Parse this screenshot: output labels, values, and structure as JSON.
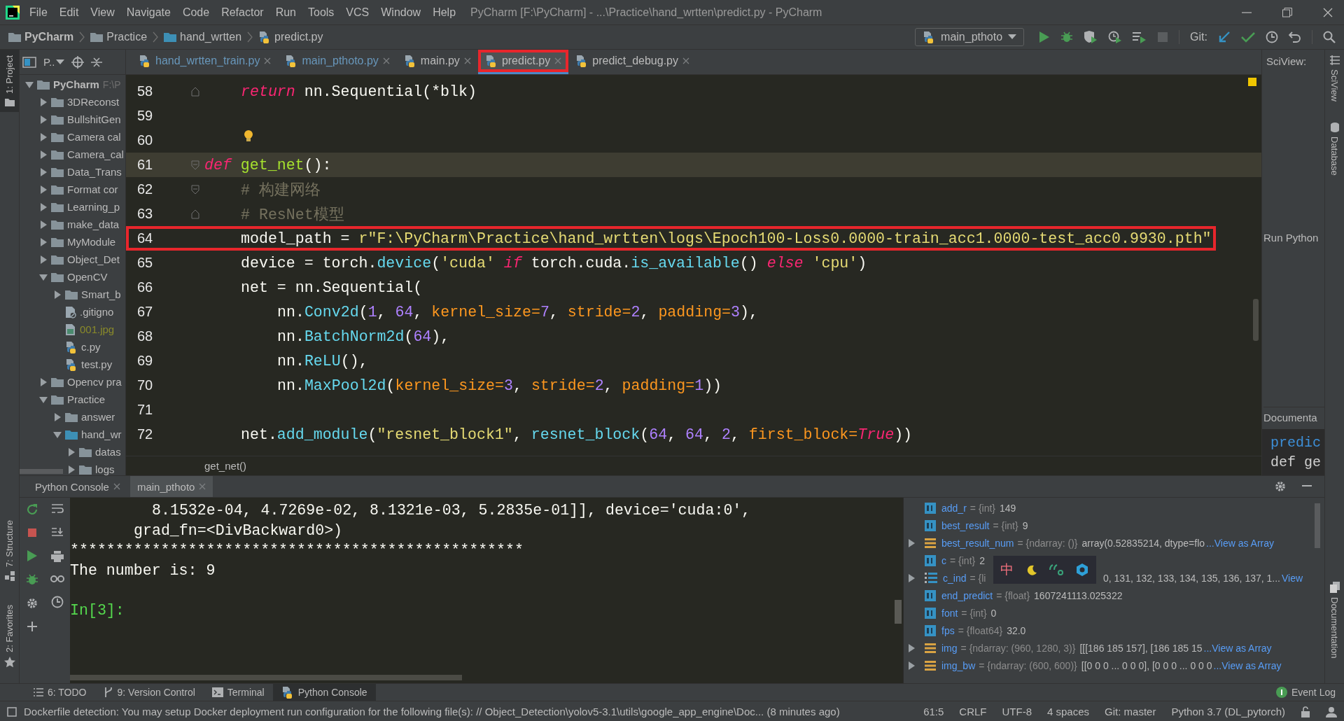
{
  "menu_bar": {
    "items": [
      "File",
      "Edit",
      "View",
      "Navigate",
      "Code",
      "Refactor",
      "Run",
      "Tools",
      "VCS",
      "Window",
      "Help"
    ],
    "title": "PyCharm [F:\\PyCharm] - ...\\Practice\\hand_wrtten\\predict.py - PyCharm"
  },
  "nav_bar": {
    "breadcrumbs": [
      {
        "label": "PyCharm",
        "kind": "project"
      },
      {
        "label": "Practice",
        "kind": "folder"
      },
      {
        "label": "hand_wrtten",
        "kind": "source-folder"
      },
      {
        "label": "predict.py",
        "kind": "python"
      }
    ],
    "run_config": "main_pthoto",
    "git_label": "Git:"
  },
  "left_strip": [
    {
      "label": "1: Project",
      "selected": true
    },
    {
      "label": "7: Structure",
      "selected": false
    },
    {
      "label": "2: Favorites",
      "selected": false
    }
  ],
  "project": {
    "header": "P..",
    "tree": [
      {
        "label": "PyCharm",
        "hint": "F:\\P",
        "kind": "folder",
        "expanded": true,
        "children": [
          {
            "label": "3DReconst",
            "kind": "folder",
            "expanded": false
          },
          {
            "label": "BullshitGen",
            "kind": "folder",
            "expanded": false
          },
          {
            "label": "Camera cal",
            "kind": "folder",
            "expanded": false
          },
          {
            "label": "Camera_cal",
            "kind": "folder",
            "expanded": false
          },
          {
            "label": "Data_Trans",
            "kind": "folder",
            "expanded": false
          },
          {
            "label": "Format cor",
            "kind": "folder",
            "expanded": false
          },
          {
            "label": "Learning_p",
            "kind": "folder",
            "expanded": false
          },
          {
            "label": "make_data",
            "kind": "folder",
            "expanded": false
          },
          {
            "label": "MyModule",
            "kind": "folder",
            "expanded": false
          },
          {
            "label": "Object_Det",
            "kind": "folder",
            "expanded": false
          },
          {
            "label": "OpenCV",
            "kind": "folder",
            "expanded": true,
            "children": [
              {
                "label": "Smart_b",
                "kind": "folder",
                "expanded": false
              },
              {
                "label": ".gitigno",
                "kind": "ignore-file"
              },
              {
                "label": "001.jpg",
                "kind": "image"
              },
              {
                "label": "c.py",
                "kind": "python"
              },
              {
                "label": "test.py",
                "kind": "python"
              }
            ]
          },
          {
            "label": "Opencv pra",
            "kind": "folder",
            "expanded": false
          },
          {
            "label": "Practice",
            "kind": "folder",
            "expanded": true,
            "children": [
              {
                "label": "answer",
                "kind": "folder",
                "expanded": false
              },
              {
                "label": "hand_wr",
                "kind": "source-folder",
                "expanded": true,
                "children": [
                  {
                    "label": "datas",
                    "kind": "folder",
                    "expanded": false
                  },
                  {
                    "label": "logs",
                    "kind": "folder",
                    "expanded": false
                  }
                ]
              }
            ]
          }
        ]
      }
    ]
  },
  "editor": {
    "tabs": [
      {
        "label": "hand_wrtten_train.py",
        "modified": true,
        "selected": false,
        "annotated": false
      },
      {
        "label": "main_pthoto.py",
        "modified": true,
        "selected": false,
        "annotated": false
      },
      {
        "label": "main.py",
        "modified": false,
        "selected": false,
        "annotated": false
      },
      {
        "label": "predict.py",
        "modified": false,
        "selected": true,
        "annotated": true
      },
      {
        "label": "predict_debug.py",
        "modified": false,
        "selected": false,
        "annotated": false
      }
    ],
    "lines": [
      {
        "number": "58",
        "kind": "body",
        "fold_end": true,
        "tokens": [
          {
            "kind": "keyword",
            "text": "return"
          },
          {
            "kind": "plain",
            "text": " nn.Sequential(*blk)"
          }
        ]
      },
      {
        "number": "59",
        "kind": "blank"
      },
      {
        "number": "60",
        "kind": "blank",
        "intention_bulb": true
      },
      {
        "number": "61",
        "kind": "top",
        "fold_start": true,
        "current": true,
        "tokens": [
          {
            "kind": "keyword",
            "text": "def "
          },
          {
            "kind": "function",
            "text": "get_net"
          },
          {
            "kind": "plain",
            "text": "():"
          }
        ]
      },
      {
        "number": "62",
        "kind": "body",
        "fold_start": true,
        "tokens": [
          {
            "kind": "comment",
            "text": "# 构建网络"
          }
        ]
      },
      {
        "number": "63",
        "kind": "body",
        "fold_end": true,
        "tokens": [
          {
            "kind": "comment",
            "text": "# ResNet模型"
          }
        ]
      },
      {
        "number": "64",
        "kind": "body",
        "annotated": true,
        "tokens": [
          {
            "kind": "plain",
            "text": "model_path = "
          },
          {
            "kind": "string",
            "text": "r\"F:\\PyCharm\\Practice\\hand_wrtten\\logs\\Epoch100-Loss0.0000-train_acc1.0000-test_acc0.9930.pth\""
          }
        ]
      },
      {
        "number": "65",
        "kind": "body",
        "tokens": [
          {
            "kind": "plain",
            "text": "device = torch."
          },
          {
            "kind": "call",
            "text": "device"
          },
          {
            "kind": "plain",
            "text": "("
          },
          {
            "kind": "string",
            "text": "'cuda'"
          },
          {
            "kind": "keyword",
            "text": " if "
          },
          {
            "kind": "plain",
            "text": "torch.cuda."
          },
          {
            "kind": "call",
            "text": "is_available"
          },
          {
            "kind": "plain",
            "text": "() "
          },
          {
            "kind": "keyword",
            "text": "else "
          },
          {
            "kind": "string",
            "text": "'cpu'"
          },
          {
            "kind": "plain",
            "text": ")"
          }
        ]
      },
      {
        "number": "66",
        "kind": "body",
        "tokens": [
          {
            "kind": "plain",
            "text": "net = nn.Sequential("
          }
        ]
      },
      {
        "number": "67",
        "kind": "nested",
        "tokens": [
          {
            "kind": "plain",
            "text": "nn."
          },
          {
            "kind": "call",
            "text": "Conv2d"
          },
          {
            "kind": "plain",
            "text": "("
          },
          {
            "kind": "number",
            "text": "1"
          },
          {
            "kind": "plain",
            "text": ", "
          },
          {
            "kind": "number",
            "text": "64"
          },
          {
            "kind": "plain",
            "text": ", "
          },
          {
            "kind": "param",
            "text": "kernel_size="
          },
          {
            "kind": "number",
            "text": "7"
          },
          {
            "kind": "plain",
            "text": ", "
          },
          {
            "kind": "param",
            "text": "stride="
          },
          {
            "kind": "number",
            "text": "2"
          },
          {
            "kind": "plain",
            "text": ", "
          },
          {
            "kind": "param",
            "text": "padding="
          },
          {
            "kind": "number",
            "text": "3"
          },
          {
            "kind": "plain",
            "text": "),"
          }
        ]
      },
      {
        "number": "68",
        "kind": "nested",
        "tokens": [
          {
            "kind": "plain",
            "text": "nn."
          },
          {
            "kind": "call",
            "text": "BatchNorm2d"
          },
          {
            "kind": "plain",
            "text": "("
          },
          {
            "kind": "number",
            "text": "64"
          },
          {
            "kind": "plain",
            "text": "),"
          }
        ]
      },
      {
        "number": "69",
        "kind": "nested",
        "tokens": [
          {
            "kind": "plain",
            "text": "nn."
          },
          {
            "kind": "call",
            "text": "ReLU"
          },
          {
            "kind": "plain",
            "text": "(),"
          }
        ]
      },
      {
        "number": "70",
        "kind": "nested",
        "tokens": [
          {
            "kind": "plain",
            "text": "nn."
          },
          {
            "kind": "call",
            "text": "MaxPool2d"
          },
          {
            "kind": "plain",
            "text": "("
          },
          {
            "kind": "param",
            "text": "kernel_size="
          },
          {
            "kind": "number",
            "text": "3"
          },
          {
            "kind": "plain",
            "text": ", "
          },
          {
            "kind": "param",
            "text": "stride="
          },
          {
            "kind": "number",
            "text": "2"
          },
          {
            "kind": "plain",
            "text": ", "
          },
          {
            "kind": "param",
            "text": "padding="
          },
          {
            "kind": "number",
            "text": "1"
          },
          {
            "kind": "plain",
            "text": "))"
          }
        ]
      },
      {
        "number": "71",
        "kind": "blank"
      },
      {
        "number": "72",
        "kind": "body",
        "tokens": [
          {
            "kind": "plain",
            "text": "net."
          },
          {
            "kind": "call",
            "text": "add_module"
          },
          {
            "kind": "plain",
            "text": "("
          },
          {
            "kind": "string",
            "text": "\"resnet_block1\""
          },
          {
            "kind": "plain",
            "text": ", "
          },
          {
            "kind": "call",
            "text": "resnet_block"
          },
          {
            "kind": "plain",
            "text": "("
          },
          {
            "kind": "number",
            "text": "64"
          },
          {
            "kind": "plain",
            "text": ", "
          },
          {
            "kind": "number",
            "text": "64"
          },
          {
            "kind": "plain",
            "text": ", "
          },
          {
            "kind": "number",
            "text": "2"
          },
          {
            "kind": "plain",
            "text": ", "
          },
          {
            "kind": "param",
            "text": "first_block="
          },
          {
            "kind": "keyword",
            "text": "True"
          },
          {
            "kind": "plain",
            "text": "))"
          }
        ]
      }
    ],
    "breadcrumb": "get_net()"
  },
  "sciview": {
    "title": "SciView:",
    "run_label": "Run Python",
    "doc_title": "Documenta",
    "doc_lines": [
      "predic",
      "def ge"
    ]
  },
  "right_strip": [
    {
      "label": "SciView"
    },
    {
      "label": "Database"
    },
    {
      "label": "Documentation"
    }
  ],
  "console": {
    "tabs": [
      {
        "label": "Python Console",
        "selected": false
      },
      {
        "label": "main_pthoto",
        "selected": true
      }
    ],
    "output": [
      {
        "kind": "tensor-row",
        "text": "8.1532e-04, 4.7269e-02, 8.1321e-03, 5.2835e-01]], device='cuda:0',"
      },
      {
        "kind": "tensor-tail",
        "text": "grad_fn=<DivBackward0>)"
      },
      {
        "kind": "plain",
        "text": "**************************************************"
      },
      {
        "kind": "plain",
        "text": "The number is: 9"
      },
      {
        "kind": "prompt",
        "text": "In[3]:"
      }
    ],
    "variables": [
      {
        "name": "add_r",
        "type": "= {int}",
        "value": "149",
        "kind": "scalar",
        "expandable": false
      },
      {
        "name": "best_result",
        "type": "= {int}",
        "value": "9",
        "kind": "scalar",
        "expandable": false
      },
      {
        "name": "best_result_num",
        "type": "= {ndarray: ()}",
        "value": "array(0.52835214, dtype=flo",
        "link": "...View as Array",
        "kind": "array",
        "expandable": true
      },
      {
        "name": "c",
        "type": "= {int}",
        "value": "2",
        "kind": "scalar",
        "expandable": false
      },
      {
        "name": "c_ind",
        "type": "= {li",
        "value": "0, 131, 132, 133, 134, 135, 136, 137, 1...",
        "link": "View",
        "kind": "list",
        "expandable": true,
        "obscured": true
      },
      {
        "name": "end_predict",
        "type": "= {float}",
        "value": "1607241113.025322",
        "kind": "scalar",
        "expandable": false
      },
      {
        "name": "font",
        "type": "= {int}",
        "value": "0",
        "kind": "scalar",
        "expandable": false
      },
      {
        "name": "fps",
        "type": "= {float64}",
        "value": "32.0",
        "kind": "scalar",
        "expandable": false
      },
      {
        "name": "img",
        "type": "= {ndarray: (960, 1280, 3)}",
        "value": "[[[186 185 157],  [186 185 15",
        "link": "...View as Array",
        "kind": "array",
        "expandable": true
      },
      {
        "name": "img_bw",
        "type": "= {ndarray: (600, 600)}",
        "value": "[[0 0 0 ... 0 0 0], [0 0 0 ... 0 0 0",
        "link": "...View as Array",
        "kind": "array",
        "expandable": true
      }
    ],
    "ime_toolbar": {
      "label": "中"
    }
  },
  "bottom_tabs": [
    {
      "label": "6: TODO",
      "kind": "list",
      "selected": false
    },
    {
      "label": "9: Version Control",
      "kind": "branch",
      "selected": false
    },
    {
      "label": "Terminal",
      "kind": "terminal",
      "selected": false
    },
    {
      "label": "Python Console",
      "kind": "python",
      "selected": true
    }
  ],
  "event_log": "Event Log",
  "status_bar": {
    "message": "Dockerfile detection: You may setup Docker deployment run configuration for the following file(s): // Object_Detection\\yolov5-3.1\\utils\\google_app_engine\\Doc... (8 minutes ago)",
    "items": [
      "61:5",
      "CRLF",
      "UTF-8",
      "4 spaces",
      "Git: master",
      "Python 3.7 (DL_pytorch)"
    ]
  }
}
